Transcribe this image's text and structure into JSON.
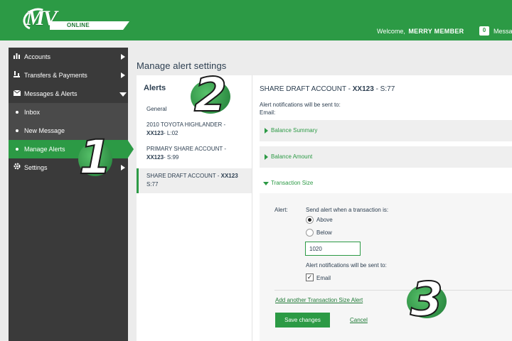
{
  "header": {
    "logo_mv": "MV",
    "logo_online": "ONLINE",
    "welcome_label": "Welcome,",
    "user_name": "MERRY MEMBER",
    "messages_count": "0",
    "messages_label": "Messa"
  },
  "sidebar": {
    "items": [
      {
        "label": "Accounts",
        "icon": "bar-chart-icon"
      },
      {
        "label": "Transfers & Payments",
        "icon": "transfer-icon"
      },
      {
        "label": "Messages & Alerts",
        "icon": "envelope-icon"
      },
      {
        "label": "Settings",
        "icon": "gear-icon"
      }
    ],
    "subitems": [
      {
        "label": "Inbox"
      },
      {
        "label": "New Message"
      },
      {
        "label": "Manage Alerts"
      }
    ]
  },
  "page": {
    "title": "Manage alert settings"
  },
  "alerts": {
    "title": "Alerts",
    "list": [
      {
        "line1": "General",
        "acct": "",
        "suffix": ""
      },
      {
        "line1": "2010 TOYOTA HIGHLANDER -",
        "acct": "XX123",
        "suffix": "- L:02"
      },
      {
        "line1": "PRIMARY SHARE ACCOUNT -",
        "acct": "XX123",
        "suffix": "- S:99"
      },
      {
        "line1": "SHARE DRAFT ACCOUNT -",
        "acct": "XX123",
        "suffix": "S:77"
      }
    ]
  },
  "settings": {
    "account_name": "SHARE DRAFT ACCOUNT -",
    "account_num": "XX123",
    "account_suffix": "- S:77",
    "notify_text": "Alert notifications will be sent to:",
    "email_label": "Email:",
    "sections": [
      {
        "label": "Balance Summary",
        "expanded": false
      },
      {
        "label": "Balance Amount",
        "expanded": false
      },
      {
        "label": "Transaction Size",
        "expanded": true
      }
    ],
    "form": {
      "alert_label": "Alert:",
      "send_when": "Send alert when a transaction is:",
      "option_above": "Above",
      "option_below": "Below",
      "amount": "1020",
      "notify_text": "Alert notifications will be sent to:",
      "email_option": "Email",
      "add_link": "Add another Transaction Size Alert",
      "save_label": "Save changes",
      "cancel_label": "Cancel"
    }
  },
  "steps": [
    "1",
    "2",
    "3"
  ],
  "colors": {
    "brand_green": "#2c9a45",
    "sidebar_dark": "#3a3a3a",
    "link_green": "#1f7a36"
  }
}
